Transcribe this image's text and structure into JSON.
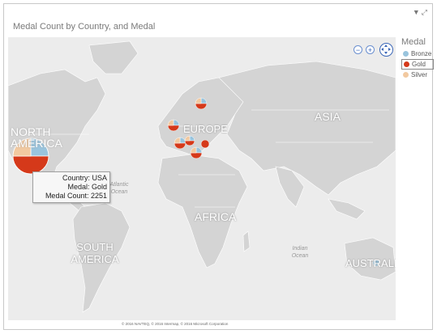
{
  "title": "Medal Count by Country, and Medal",
  "top_icons": [
    "filter-icon",
    "popout-icon"
  ],
  "map_labels": {
    "north_america": "NORTH AMERICA",
    "europe": "EUROPE",
    "asia": "ASIA",
    "africa": "AFRICA",
    "south_america": "SOUTH AMERICA",
    "australia": "AUSTRALIA",
    "atlantic": "Atlantic Ocean",
    "indian": "Indian Ocean"
  },
  "legend": {
    "title": "Medal",
    "items": [
      {
        "label": "Bronze",
        "color": "#99c4dd"
      },
      {
        "label": "Gold",
        "color": "#d5391a"
      },
      {
        "label": "Silver",
        "color": "#f2c9a0"
      }
    ],
    "selected": "Gold"
  },
  "tooltip": {
    "country": "Country: USA",
    "medal": "Medal: Gold",
    "count": "Medal Count: 2251"
  },
  "nav_icons": [
    "zoom-out-icon",
    "zoom-in-icon",
    "pan-icon"
  ],
  "copyright": "© 2016 NAVTEQ, © 2016 Intermap, © 2016 Microsoft Corporation",
  "colors": {
    "bronze": "#99c4dd",
    "gold": "#d5391a",
    "silver": "#f2c9a0",
    "land": "#d3d3d3",
    "water": "#ececec"
  }
}
